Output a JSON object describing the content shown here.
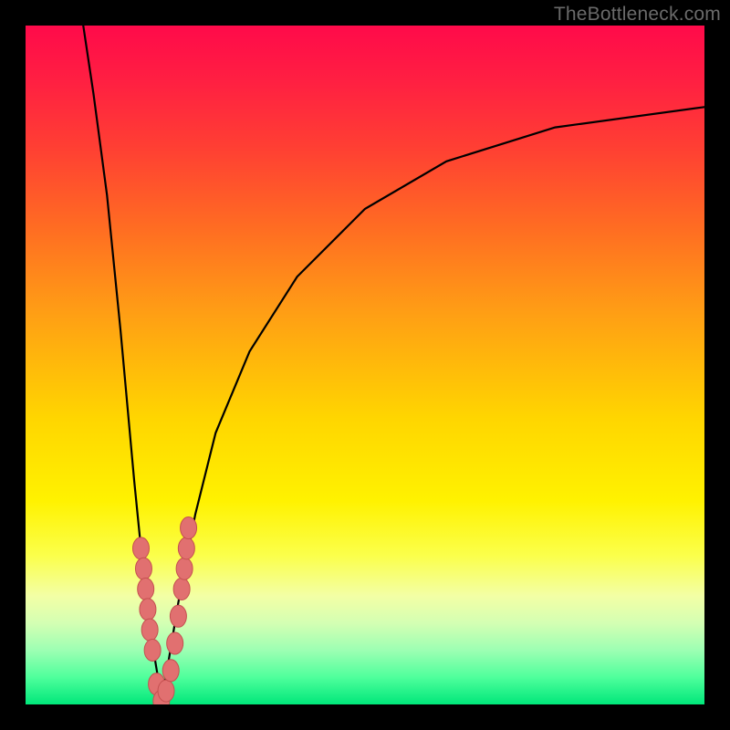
{
  "watermark": "TheBottleneck.com",
  "chart_data": {
    "type": "line",
    "title": "",
    "xlabel": "",
    "ylabel": "",
    "xlim": [
      0,
      100
    ],
    "ylim": [
      0,
      100
    ],
    "note": "Vertical gradient background from red (top, bottleneck ≈100%) through orange/yellow to green (bottom, bottleneck ≈0%). Two black curves form a V-shaped bottleneck plot meeting near x≈20. Salmon-colored dots cluster along the lower portion of the V near the green band.",
    "series": [
      {
        "name": "left-curve",
        "x": [
          8.5,
          10,
          12,
          14,
          16,
          17.5,
          18.5,
          19.5,
          20
        ],
        "y": [
          100,
          90,
          75,
          55,
          33,
          18,
          10,
          4,
          0
        ]
      },
      {
        "name": "right-curve",
        "x": [
          20,
          21,
          22.5,
          25,
          28,
          33,
          40,
          50,
          62,
          78,
          100
        ],
        "y": [
          0,
          6,
          15,
          28,
          40,
          52,
          63,
          73,
          80,
          85,
          88
        ]
      },
      {
        "name": "dots",
        "x": [
          17.0,
          17.4,
          17.7,
          18.0,
          18.3,
          18.7,
          19.3,
          20.0,
          20.7,
          21.4,
          22.0,
          22.5,
          23.0,
          23.4,
          23.7,
          24.0
        ],
        "y": [
          23,
          20,
          17,
          14,
          11,
          8,
          3,
          0.5,
          2,
          5,
          9,
          13,
          17,
          20,
          23,
          26
        ]
      }
    ],
    "colors": {
      "curve": "#000000",
      "dots_fill": "#e17070",
      "dots_stroke": "#c55050",
      "gradient_top": "#ff0a4a",
      "gradient_bottom": "#00e77a"
    }
  }
}
